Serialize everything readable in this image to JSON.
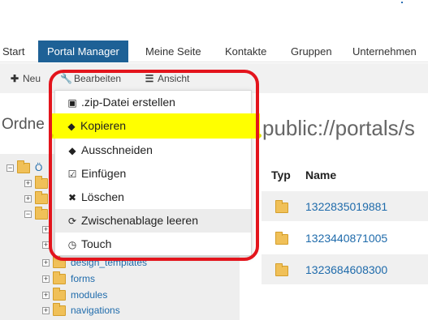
{
  "nav": {
    "items": [
      {
        "label": "Start",
        "active": false
      },
      {
        "label": "Portal Manager",
        "active": true
      },
      {
        "label": "Meine Seite",
        "active": false
      },
      {
        "label": "Kontakte",
        "active": false
      },
      {
        "label": "Gruppen",
        "active": false
      },
      {
        "label": "Unternehmen",
        "active": false
      }
    ]
  },
  "toolbar": {
    "new_label": "Neu",
    "edit_label": "Bearbeiten",
    "view_label": "Ansicht"
  },
  "left_panel": {
    "title": "Ordne"
  },
  "tree": {
    "root_label": "Ö",
    "items": [
      {
        "label": "design_templates"
      },
      {
        "label": "forms"
      },
      {
        "label": "modules"
      },
      {
        "label": "navigations"
      }
    ]
  },
  "path_title": "public://portals/s",
  "table": {
    "headers": [
      "Typ",
      "Name"
    ],
    "rows": [
      {
        "name": "1322835019881"
      },
      {
        "name": "1323440871005"
      },
      {
        "name": "1323684608300"
      }
    ]
  },
  "menu": {
    "items": [
      {
        "label": ".zip-Datei erstellen",
        "icon": "archive-icon"
      },
      {
        "label": "Kopieren",
        "icon": "tag-icon"
      },
      {
        "label": "Ausschneiden",
        "icon": "tag-icon"
      },
      {
        "label": "Einfügen",
        "icon": "check-square-icon"
      },
      {
        "label": "Löschen",
        "icon": "times-icon"
      },
      {
        "label": "Zwischenablage leeren",
        "icon": "refresh-icon"
      },
      {
        "label": "Touch",
        "icon": "clock-icon"
      }
    ]
  },
  "colors": {
    "nav_active_bg": "#1e6196",
    "link": "#1f6bab",
    "highlight": "#ffff00",
    "annotation_frame": "#e3141c"
  }
}
